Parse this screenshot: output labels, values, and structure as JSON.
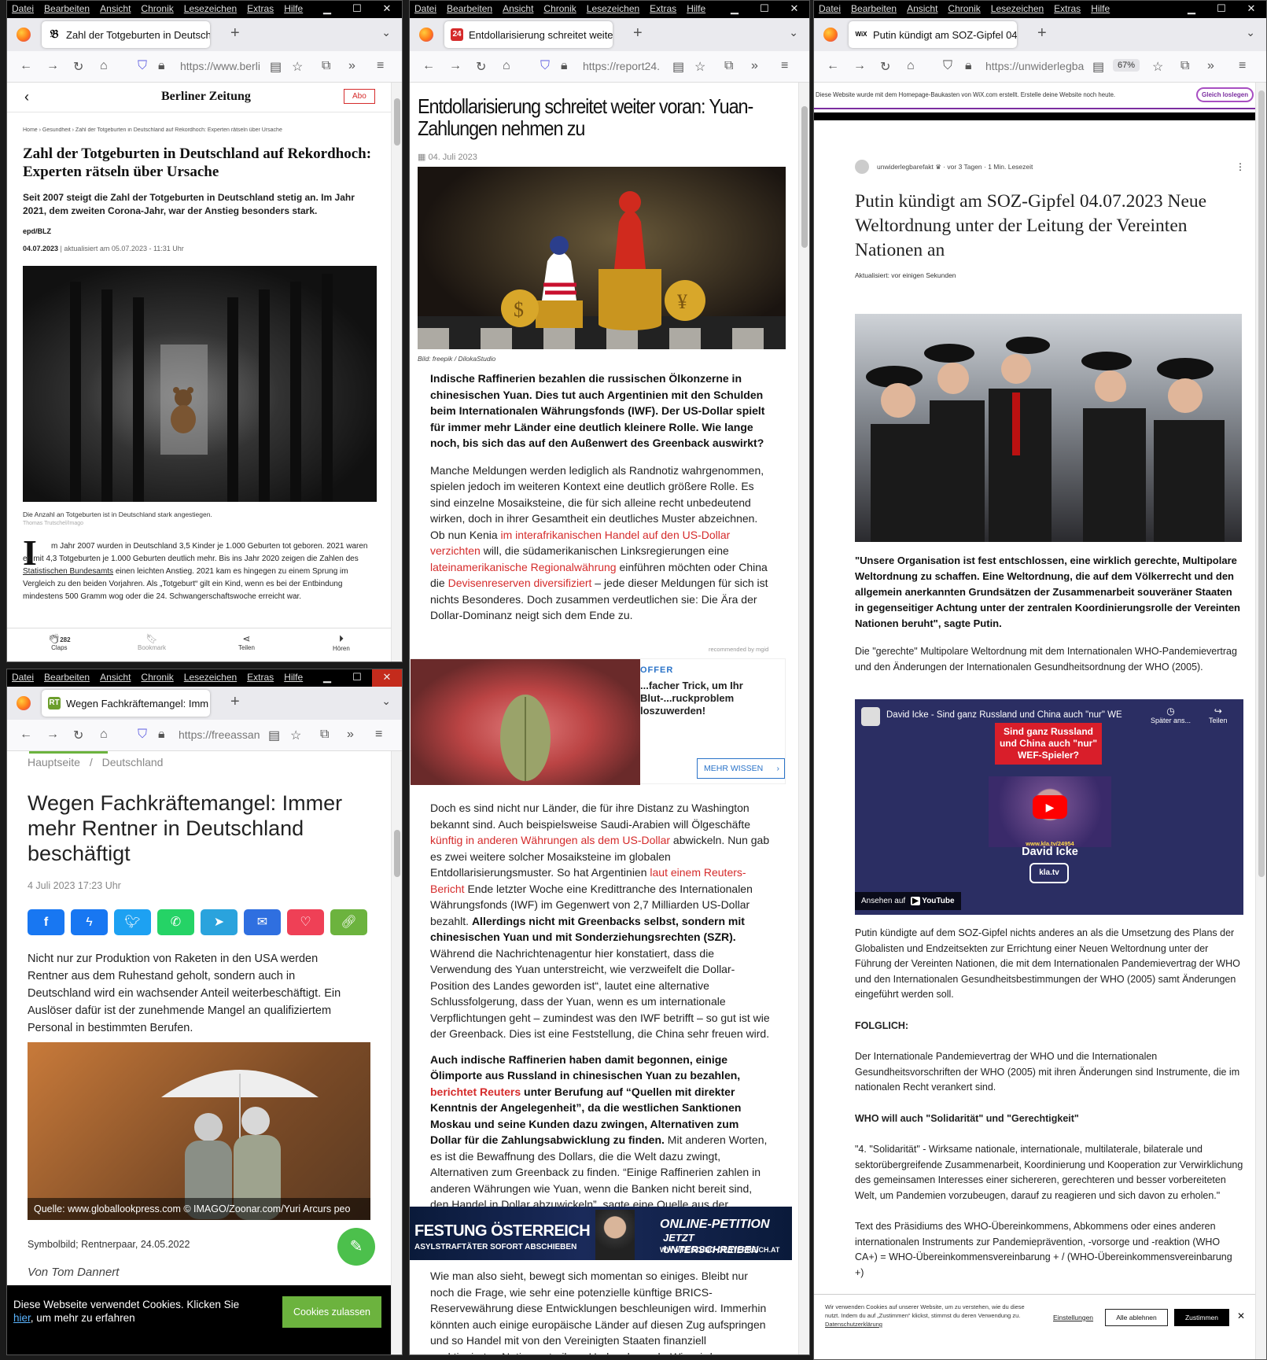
{
  "menu": [
    "Datei",
    "Bearbeiten",
    "Ansicht",
    "Chronik",
    "Lesezeichen",
    "Extras",
    "Hilfe"
  ],
  "w1": {
    "tab_title": "Zahl der Totgeburten in Deutschl",
    "url": "https://www.berli",
    "site": "Berliner Zeitung",
    "abo": "Abo",
    "breadcrumb": "Home › Gesundheit › Zahl der Totgeburten in Deutschland auf Rekordhoch: Experten rätseln über Ursache",
    "headline": "Zahl der Totgeburten in Deutschland auf Rekordhoch: Experten rätseln über Ursache",
    "lead": "Seit 2007 steigt die Zahl der Totgeburten in Deutschland stetig an. Im Jahr 2021, dem zweiten Corona-Jahr, war der Anstieg besonders stark.",
    "author": "epd/BLZ",
    "date": "04.07.2023",
    "updated": " | aktualisiert am 05.07.2023 - 11:31 Uhr",
    "caption": "Die Anzahl an Totgeburten ist in Deutschland stark angestiegen.",
    "credit": "Thomas Trutschel/Imago",
    "dropcap": "I",
    "body1": "m Jahr 2007 wurden in Deutschland 3,5 Kinder je 1.000 Geburten tot geboren. 2021 waren es mit 4,3 Totgeburten je 1.000 Geburten deutlich mehr. Bis ins Jahr 2020 zeigen die Zahlen des ",
    "body_link": "Statistischen Bundesamts",
    "body2": " einen leichten Anstieg. 2021 kam es hingegen zu einem Sprung im Vergleich zu den beiden Vorjahren. Als „Totgeburt“ gilt ein Kind, wenn es bei der Entbindung mindestens 500 Gramm wog oder die 24. Schwangerschaftswoche erreicht war.",
    "claps_count": "282",
    "claps": "Claps",
    "bookmark": "Bookmark",
    "share": "Teilen",
    "listen": "Hören"
  },
  "w2": {
    "tab_title": "Wegen Fachkräftemangel: Imm",
    "url": "https://freeassan",
    "breadcrumb_home": "Hauptseite",
    "breadcrumb_sep": "/",
    "breadcrumb_cat": "Deutschland",
    "headline": "Wegen Fachkräftemangel: Immer mehr Rentner in Deutschland beschäftigt",
    "date": "4 Juli 2023 17:23 Uhr",
    "body": "Nicht nur zur Produktion von Raketen in den USA werden Rentner aus dem Ruhestand geholt, sondern auch in Deutschland wird ein wachsender Anteil weiterbeschäftigt. Ein Auslöser dafür ist der zunehmende Mangel an qualifiziertem Personal in bestimmten Berufen.",
    "img_caption": "Quelle: www.globallookpress.com © IMAGO/Zoonar.com/Yuri Arcurs peo",
    "symbol": "Symbolbild; Rentnerpaar, 24.05.2022",
    "author": "Von Tom Dannert",
    "cookie_text": "Diese Webseite verwendet Cookies. Klicken Sie ",
    "cookie_link": "hier",
    "cookie_text2": ", um mehr zu erfahren",
    "cookie_btn": "Cookies zulassen"
  },
  "w3": {
    "tab_title": "Entdollarisierung schreitet weite",
    "url": "https://report24.",
    "headline": "Entdollarisierung schreitet weiter voran: Yuan-Zahlungen nehmen zu",
    "date": "04. Juli 2023",
    "credit": "Bild: freepik / DilokaStudio",
    "lead": "Indische Raffinerien bezahlen die russischen Ölkonzerne in chinesischen Yuan. Dies tut auch Argentinien mit den Schulden beim Internationalen Währungsfonds (IWF). Der US-Dollar spielt für immer mehr Länder eine deutlich kleinere Rolle. Wie lange noch, bis sich das auf den Außenwert des Greenback auswirkt?",
    "p1a": "Manche Meldungen werden lediglich als Randnotiz wahrgenommen, spielen jedoch im weiteren Kontext eine deutlich größere Rolle. Es sind einzelne Mosaiksteine, die für sich alleine recht unbedeutend wirken, doch in ihrer Gesamtheit ein deutliches Muster abzeichnen. Ob nun Kenia ",
    "p1l1": "im interafrikanischen Handel auf den US-Dollar verzichten",
    "p1b": " will, die südamerikanischen Linksregierungen eine ",
    "p1l2": "lateinamerikanische Regionalwährung",
    "p1c": " einführen möchten oder China die ",
    "p1l3": "Devisenreserven diversifiziert",
    "p1d": " – jede dieser Meldungen für sich ist nichts Besonderes. Doch zusammen verdeutlichen sie: Die Ära der Dollar-Dominanz neigt sich dem Ende zu.",
    "recommended": "recommended by mgid",
    "ad_tag": "OFFER",
    "ad_text": "...facher Trick, um Ihr Blut-...ruckproblem loszuwerden!",
    "ad_btn": "MEHR WISSEN",
    "p2a": "Doch es sind nicht nur Länder, die für ihre Distanz zu Washington bekannt sind. Auch beispielsweise Saudi-Arabien will Ölgeschäfte ",
    "p2l1": "künftig in anderen Währungen als dem US-Dollar",
    "p2b": " abwickeln. Nun gab es zwei weitere solcher Mosaiksteine im globalen Entdollarisierungsmuster. So hat Argentinien ",
    "p2l2": "laut einem Reuters-Bericht",
    "p2c": " Ende letzter Woche eine Kredittranche des Internationalen Währungsfonds (IWF) im Gegenwert von 2,7 Milliarden US-Dollar bezahlt. ",
    "p2bold": "Allerdings nicht mit Greenbacks selbst, sondern mit chinesischen Yuan und mit Sonderziehungsrechten (SZR).",
    "p2d": " Während die Nachrichtenagentur hier konstatiert, dass die Verwendung des Yuan unterstreicht, wie verzweifelt die Dollar-Position des Landes geworden ist“, lautet eine alternative Schlussfolgerung, dass der Yuan, wenn es um internationale Verpflichtungen geht – zumindest was den IWF betrifft – so gut ist wie der Greenback. Dies ist eine Feststellung, die China sehr freuen wird.",
    "p3bold1": "Auch indische Raffinerien haben damit begonnen, einige Ölimporte aus Russland in chinesischen Yuan zu bezahlen, ",
    "p3link": "berichtet Reuters",
    "p3bold2": " unter Berufung auf “Quellen mit direkter Kenntnis der Angelegenheit”, da die westlichen Sanktionen Moskau und seine Kunden dazu zwingen, Alternativen zum Dollar für die Zahlungsabwicklung zu finden.",
    "p3": " Mit anderen Worten, es ist die Bewaffnung des Dollars, die die Welt dazu zwingt, Alternativen zum Greenback zu finden. “Einige Raffinerien zahlen in anderen Währungen wie Yuan, wenn die Banken nicht bereit sind, den Handel in Dollar abzuwickeln”, sagte eine Quelle aus der indischen Regierung der Nachrichtenagentur.",
    "banner_left": "FESTUNG ÖSTERREICH",
    "banner_sub": "ASYLSTRAFTÄTER SOFORT ABSCHIEBEN",
    "banner_right": "ONLINE-PETITION",
    "banner_right2": "JETZT UNTERSCHREIBEN",
    "banner_url": "WWW.FESTUNG-OESTERREICH.AT",
    "p4": "Wie man also sieht, bewegt sich momentan so einiges. Bleibt nur noch die Frage, wie sehr eine potenzielle künftige BRICS-Reservewährung diese Entwicklungen beschleunigen wird. Immerhin könnten auch einige europäische Länder auf diesen Zug aufspringen und so Handel mit von den Vereinigten Staaten finanziell sanktionierten Nationen treiben. Und mehr noch: Wie wird Washington darauf reagieren, wenn es die..."
  },
  "w4": {
    "tab_title": "Putin kündigt am SOZ-Gipfel 04",
    "url": "https://unwiderlegba",
    "zoom": "67%",
    "wix_banner": "Diese Website wurde mit dem Homepage-Baukasten von WiX.com erstellt. Erstelle deine Website noch heute.",
    "wix_btn": "Gleich loslegen",
    "author": "unwiderlegbarefakt",
    "meta": "· vor 3 Tagen · 1 Min. Lesezeit",
    "headline": "Putin kündigt am SOZ-Gipfel 04.07.2023 Neue Weltordnung unter der Leitung der Vereinten Nationen an",
    "updated": "Aktualisiert: vor einigen Sekunden",
    "quote": "\"Unsere Organisation ist fest entschlossen, eine wirklich gerechte, Multipolare Weltordnung zu schaffen. Eine Weltordnung, die auf dem Völkerrecht und den allgemein anerkannten Grundsätzen der Zusammenarbeit souveräner Staaten in gegenseitiger Achtung unter der zentralen Koordinierungsrolle der Vereinten Nationen beruht\", sagte Putin.",
    "p1": "Die \"gerechte\" Multipolare Weltordnung mit dem Internationalen WHO-Pandemievertrag und den Änderungen der Internationalen Gesundheitsordnung der WHO (2005).",
    "video_title": "David Icke - Sind ganz Russland und China auch \"nur\" WEF-S...",
    "video_later": "Später ans...",
    "video_share": "Teilen",
    "video_box": "Sind ganz Russland und China auch \"nur\" WEF-Spieler?",
    "video_url": "www.kla.tv/24954",
    "video_name": "David Icke",
    "video_logo": "kla.tv",
    "video_watch": "Ansehen auf",
    "video_yt": "YouTube",
    "p2": "Putin kündigte auf dem SOZ-Gipfel nichts anderes an als die Umsetzung des Plans der Globalisten und Endzeitsekten zur Errichtung einer Neuen Weltordnung unter der Führung der Vereinten Nationen, die mit dem Internationalen Pandemievertrag der WHO und den Internationalen Gesundheitsbestimmungen der WHO (2005) samt Änderungen eingeführt werden soll.",
    "h_folglich": "FOLGLICH:",
    "p3": "Der Internationale Pandemievertrag der WHO und die Internationalen Gesundheitsvorschriften der WHO (2005) mit ihren Änderungen sind Instrumente, die im nationalen Recht verankert sind.",
    "h_who": "WHO will auch \"Solidarität\" und \"Gerechtigkeit\"",
    "p4": "\"4. \"Solidarität\" - Wirksame nationale, internationale, multilaterale, bilaterale und sektorübergreifende Zusammenarbeit, Koordinierung und Kooperation zur Verwirklichung des gemeinsamen Interesses einer sichereren, gerechteren und besser vorbereiteten Welt, um Pandemien vorzubeugen, darauf zu reagieren und sich davon zu erholen.\"",
    "p5": "Text des Präsidiums des WHO-Übereinkommens, Abkommens oder eines anderen internationalen Instruments zur Pandemieprävention, -vorsorge und -reaktion (WHO CA+) = WHO-Übereinkommensvereinbarung + / (WHO-Übereinkommensvereinbarung +)",
    "cookie_text": "Wir verwenden Cookies auf unserer Website, um zu verstehen, wie du diese nutzt. Indem du auf „Zustimmen“ klickst, stimmst du deren Verwendung zu. ",
    "cookie_link": "Datenschutzerklärung",
    "cookie_settings": "Einstellungen",
    "cookie_reject": "Alle ablehnen",
    "cookie_accept": "Zustimmen"
  }
}
